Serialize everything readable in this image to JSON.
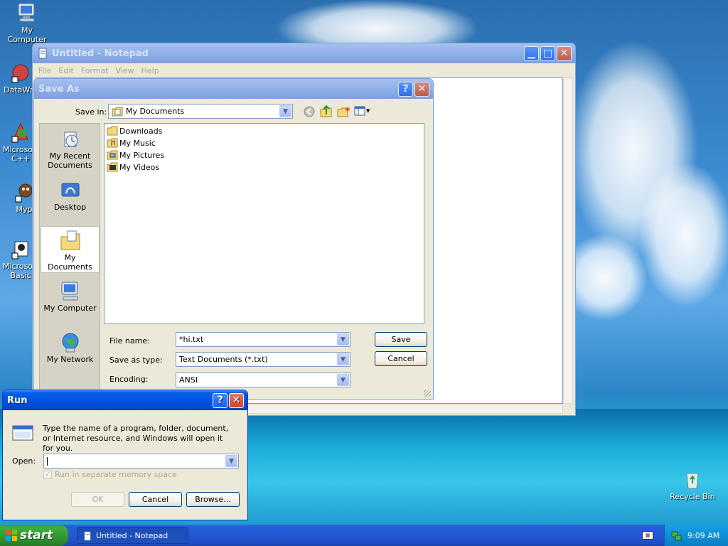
{
  "desktop": {
    "icons": [
      {
        "label": "My Computer"
      },
      {
        "label": "DataWar"
      },
      {
        "label": "Microsoft C++"
      },
      {
        "label": "Myp"
      },
      {
        "label": "Microsoft Basic"
      },
      {
        "label": "Recycle Bin"
      }
    ]
  },
  "notepad": {
    "title": "Untitled - Notepad",
    "menu": [
      "File",
      "Edit",
      "Format",
      "View",
      "Help"
    ]
  },
  "save_as": {
    "title": "Save As",
    "save_in_label": "Save in:",
    "save_in_value": "My Documents",
    "places": [
      "My Recent Documents",
      "Desktop",
      "My Documents",
      "My Computer",
      "My Network"
    ],
    "files": [
      "Downloads",
      "My Music",
      "My Pictures",
      "My Videos"
    ],
    "file_name_label": "File name:",
    "file_name_value": "*hi.txt",
    "save_type_label": "Save as type:",
    "save_type_value": "Text Documents (*.txt)",
    "encoding_label": "Encoding:",
    "encoding_value": "ANSI",
    "save_button": "Save",
    "cancel_button": "Cancel"
  },
  "run": {
    "title": "Run",
    "description": "Type the name of a program, folder, document, or Internet resource, and Windows will open it for you.",
    "open_label": "Open:",
    "open_value": "",
    "checkbox_label": "Run in separate memory space",
    "ok_button": "OK",
    "cancel_button": "Cancel",
    "browse_button": "Browse..."
  },
  "taskbar": {
    "start_label": "start",
    "task_label": "Untitled - Notepad",
    "clock": "9:09 AM"
  },
  "colors": {
    "title_active": "#0054e3",
    "title_inactive": "#8fb0e8",
    "dialog_bg": "#ece9d8"
  }
}
